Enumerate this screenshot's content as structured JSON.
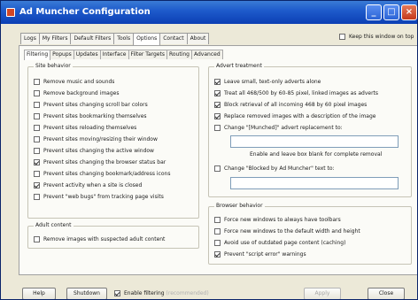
{
  "window": {
    "title": "Ad Muncher Configuration"
  },
  "top_tabs": [
    "Logs",
    "My Filters",
    "Default Filters",
    "Tools",
    "Options",
    "Contact",
    "About"
  ],
  "keep_on_top": {
    "label": "Keep this window on top",
    "checked": false
  },
  "sub_tabs": [
    "Filtering",
    "Popups",
    "Updates",
    "Interface",
    "Filter Targets",
    "Routing",
    "Advanced"
  ],
  "site_behavior": {
    "title": "Site behavior",
    "items": [
      {
        "label": "Remove music and sounds",
        "checked": false
      },
      {
        "label": "Remove background images",
        "checked": false
      },
      {
        "label": "Prevent sites changing scroll bar colors",
        "checked": false
      },
      {
        "label": "Prevent sites bookmarking themselves",
        "checked": false
      },
      {
        "label": "Prevent sites reloading themselves",
        "checked": false
      },
      {
        "label": "Prevent sites moving/resizing their window",
        "checked": false
      },
      {
        "label": "Prevent sites changing the active window",
        "checked": false
      },
      {
        "label": "Prevent sites changing the browser status bar",
        "checked": true
      },
      {
        "label": "Prevent sites changing bookmark/address icons",
        "checked": false
      },
      {
        "label": "Prevent activity when a site is closed",
        "checked": true
      },
      {
        "label": "Prevent \"web bugs\" from tracking page visits",
        "checked": false
      }
    ]
  },
  "adult_content": {
    "title": "Adult content",
    "items": [
      {
        "label": "Remove images with suspected adult content",
        "checked": false
      }
    ]
  },
  "advert_treatment": {
    "title": "Advert treatment",
    "items": [
      {
        "label": "Leave small, text-only adverts alone",
        "checked": true
      },
      {
        "label": "Treat all 468/500 by 60-85 pixel, linked images as adverts",
        "checked": true
      },
      {
        "label": "Block retrieval of all incoming 468 by 60 pixel images",
        "checked": true
      },
      {
        "label": "Replace removed images with a description of the image",
        "checked": true
      }
    ],
    "change_munched": {
      "label": "Change \"[Munched]\" advert replacement to:",
      "checked": false,
      "value": ""
    },
    "hint": "Enable and leave box blank for complete removal",
    "change_blocked": {
      "label": "Change \"Blocked by Ad Muncher\" text to:",
      "checked": false,
      "value": ""
    }
  },
  "browser_behavior": {
    "title": "Browser behavior",
    "items": [
      {
        "label": "Force new windows to always have toolbars",
        "checked": false
      },
      {
        "label": "Force new windows to the default width and height",
        "checked": false
      },
      {
        "label": "Avoid use of outdated page content (caching)",
        "checked": false
      },
      {
        "label": "Prevent \"script error\" warnings",
        "checked": true
      }
    ]
  },
  "bottom": {
    "help": "Help",
    "shutdown": "Shutdown",
    "enable_filtering": {
      "label": "Enable filtering",
      "suffix": "(recommended)",
      "checked": true
    },
    "apply": "Apply",
    "close": "Close"
  }
}
